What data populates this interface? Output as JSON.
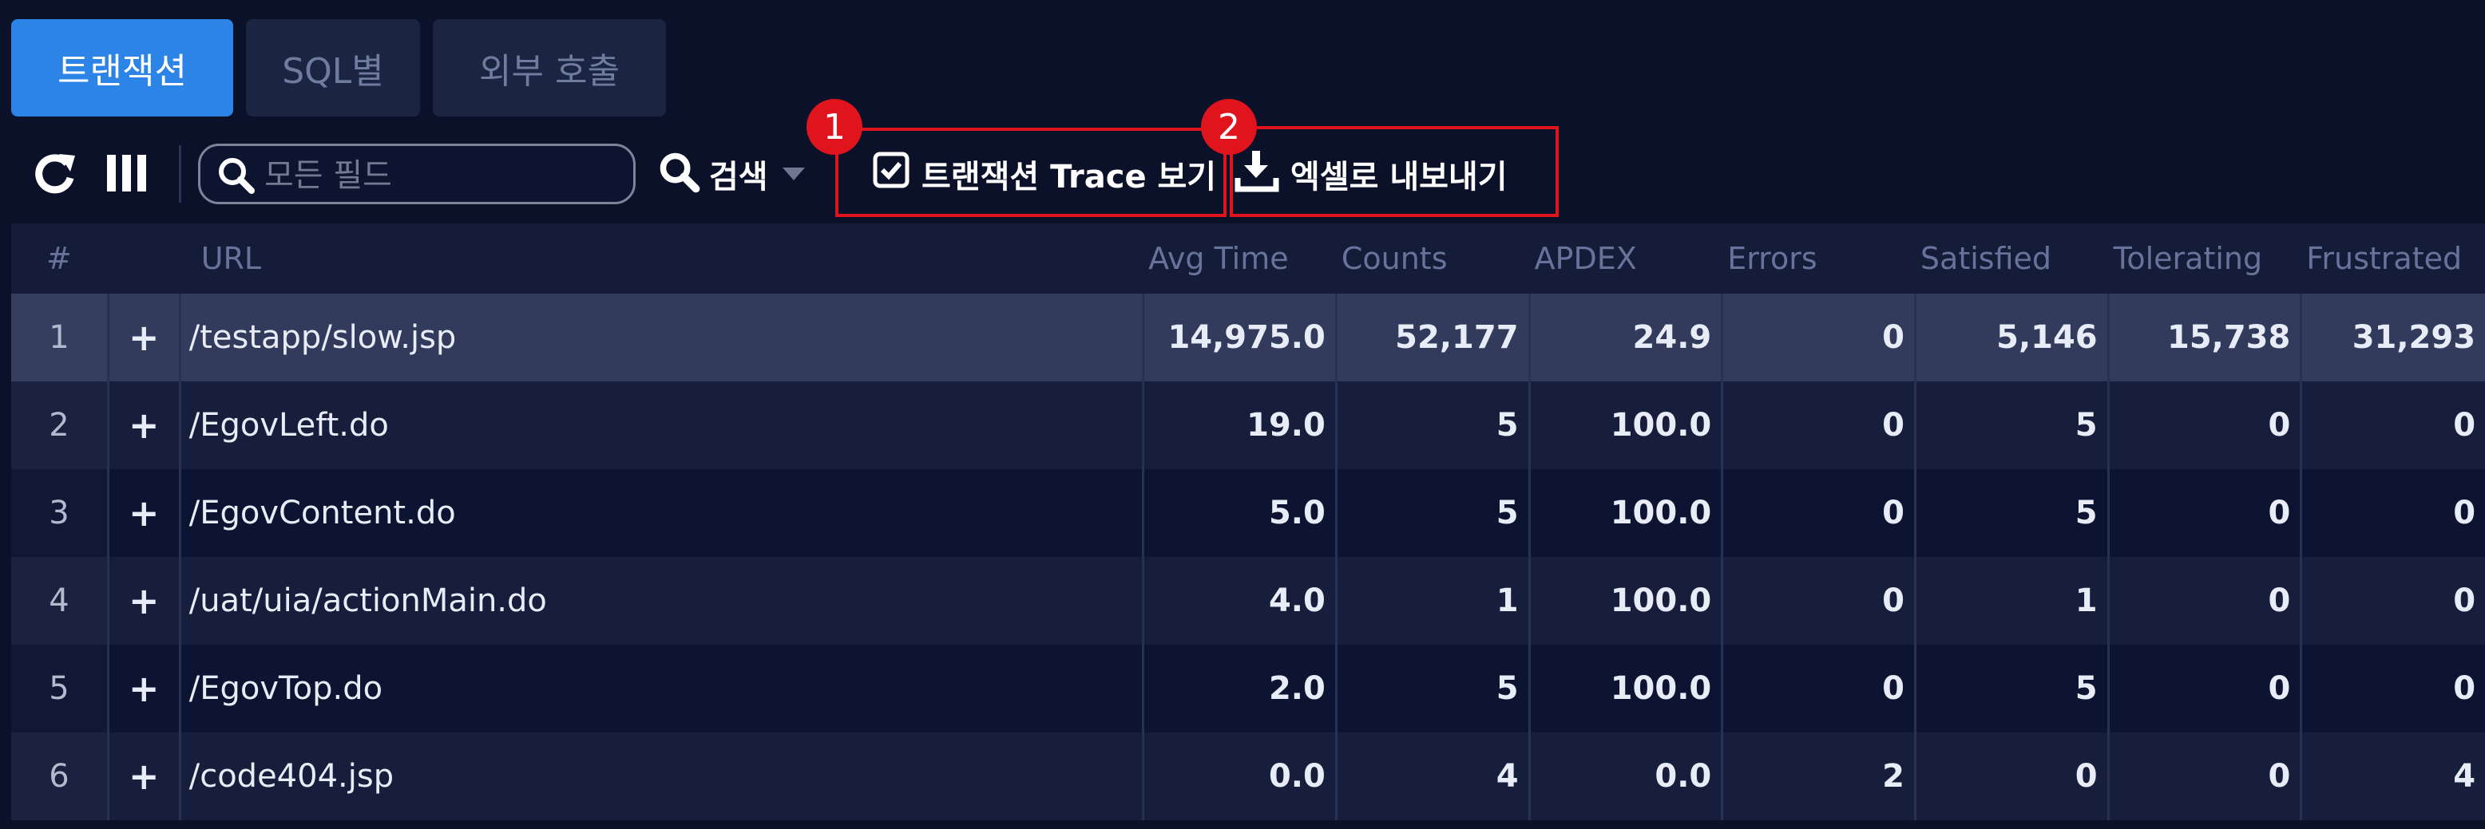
{
  "tabs": [
    {
      "label": "트랜잭션",
      "active": true
    },
    {
      "label": "SQL별",
      "active": false
    },
    {
      "label": "외부 호출",
      "active": false
    }
  ],
  "toolbar": {
    "refresh_icon": "refresh-icon",
    "columns_icon": "columns-icon",
    "search_placeholder": "모든 필드",
    "search_label": "검색",
    "trace_label": "트랜잭션 Trace 보기",
    "trace_checked": true,
    "export_label": "엑셀로 내보내기",
    "badge_1": "1",
    "badge_2": "2"
  },
  "colors": {
    "accent": "#2b84e6",
    "highlight": "#e0141c",
    "background": "#0b1128"
  },
  "table": {
    "columns": [
      "#",
      "",
      "URL",
      "Avg Time",
      "Counts",
      "APDEX",
      "Errors",
      "Satisfied",
      "Tolerating",
      "Frustrated"
    ],
    "rows": [
      {
        "num": "1",
        "expand": "+",
        "url": "/testapp/slow.jsp",
        "avg": "14,975.0",
        "counts": "52,177",
        "apdex": "24.9",
        "errors": "0",
        "satisfied": "5,146",
        "tolerating": "15,738",
        "frustrated": "31,293"
      },
      {
        "num": "2",
        "expand": "+",
        "url": "/EgovLeft.do",
        "avg": "19.0",
        "counts": "5",
        "apdex": "100.0",
        "errors": "0",
        "satisfied": "5",
        "tolerating": "0",
        "frustrated": "0"
      },
      {
        "num": "3",
        "expand": "+",
        "url": "/EgovContent.do",
        "avg": "5.0",
        "counts": "5",
        "apdex": "100.0",
        "errors": "0",
        "satisfied": "5",
        "tolerating": "0",
        "frustrated": "0"
      },
      {
        "num": "4",
        "expand": "+",
        "url": "/uat/uia/actionMain.do",
        "avg": "4.0",
        "counts": "1",
        "apdex": "100.0",
        "errors": "0",
        "satisfied": "1",
        "tolerating": "0",
        "frustrated": "0"
      },
      {
        "num": "5",
        "expand": "+",
        "url": "/EgovTop.do",
        "avg": "2.0",
        "counts": "5",
        "apdex": "100.0",
        "errors": "0",
        "satisfied": "5",
        "tolerating": "0",
        "frustrated": "0"
      },
      {
        "num": "6",
        "expand": "+",
        "url": "/code404.jsp",
        "avg": "0.0",
        "counts": "4",
        "apdex": "0.0",
        "errors": "2",
        "satisfied": "0",
        "tolerating": "0",
        "frustrated": "4"
      }
    ]
  }
}
